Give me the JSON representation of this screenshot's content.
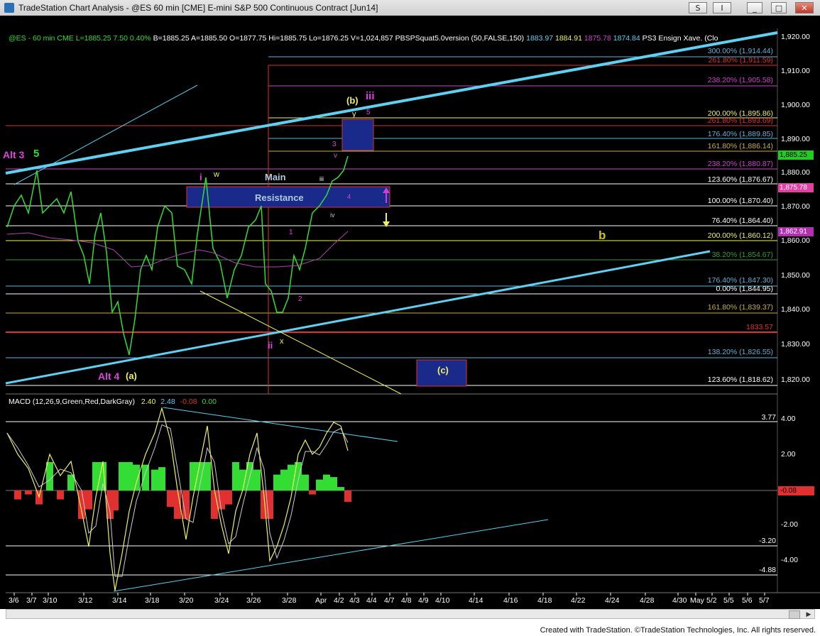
{
  "window": {
    "title": "TradeStation Chart Analysis - @ES 60 min [CME] E-mini S&P 500 Continuous Contract [Jun14]",
    "buttons": [
      "S",
      "I",
      "_",
      "□",
      "✕"
    ]
  },
  "info_bar": {
    "symbol": "@ES - 60 min  CME",
    "last": "L=1885.25 7.50 0.40%",
    "bid": "B=1885.25",
    "ask": "A=1885.50",
    "open": "O=1877.75",
    "high": "Hi=1885.75",
    "low": "Lo=1876.25",
    "volume": "V=1,024,857",
    "indicator": "PBSPSquat5.0version (50,FALSE,150)",
    "ind_values": [
      "1883.97",
      "1884.91",
      "1875.78",
      "1874.84"
    ],
    "ind2": "PS3 Ensign Xave. (Clo"
  },
  "price_axis": [
    "1,920.00",
    "1,910.00",
    "1,900.00",
    "1,890.00",
    "1,880.00",
    "1,870.00",
    "1,860.00",
    "1,850.00",
    "1,840.00",
    "1,830.00",
    "1,820.00"
  ],
  "price_badges": {
    "last": "1,885.25",
    "pink": "1,875.78",
    "magenta": "1,862.91"
  },
  "fib_labels": [
    {
      "text": "300.00% (1,914.44)",
      "color": "#5fb2d8"
    },
    {
      "text": "261.80% (1,911.59)",
      "color": "#e03030"
    },
    {
      "text": "238.20% (1,905.58)",
      "color": "#d040d0"
    },
    {
      "text": "200.00% (1,895.86)",
      "color": "#f0f060"
    },
    {
      "text": "261.80% (1,893.69)",
      "color": "#e03030"
    },
    {
      "text": "176.40% (1,889.85)",
      "color": "#5fb2d8"
    },
    {
      "text": "161.80% (1,886.14)",
      "color": "#c8b040"
    },
    {
      "text": "238.20% (1,880.87)",
      "color": "#d040d0"
    },
    {
      "text": "123.60% (1,876.67)",
      "color": "#ffffff"
    },
    {
      "text": "100.00% (1,870.40)",
      "color": "#ffffff"
    },
    {
      "text": "76.40% (1,864.40)",
      "color": "#ffffff"
    },
    {
      "text": "200.00% (1,860.12)",
      "color": "#f0f060"
    },
    {
      "text": "38.20% (1,854.67)",
      "color": "#3a9a3a"
    },
    {
      "text": "176.40% (1,847.30)",
      "color": "#5fb2d8"
    },
    {
      "text": "0.00% (1,844.95)",
      "color": "#ffffff"
    },
    {
      "text": "161.80% (1,839.37)",
      "color": "#c8b040"
    },
    {
      "text": "1833.57",
      "color": "#e03030"
    },
    {
      "text": "138.20% (1,826.55)",
      "color": "#5fb2d8"
    },
    {
      "text": "123.60% (1,818.62)",
      "color": "#ffffff"
    }
  ],
  "wave_labels": {
    "alt3": "Alt 3",
    "five": "5",
    "i": "i",
    "w": "w",
    "main": "Main",
    "resistance": "Resistance",
    "b_paren": "(b)",
    "iii": "iii",
    "y": "y",
    "five_small": "5",
    "three": "3",
    "v": "v",
    "iii_small": "iii",
    "four": "4",
    "iv": "iv",
    "one": "1",
    "two": "2",
    "ii": "ii",
    "x": "x",
    "alt4": "Alt 4",
    "a_paren": "(a)",
    "c_paren": "(c)",
    "b": "b"
  },
  "macd": {
    "label": "MACD (12,26,9,Green,Red,DarkGray)",
    "values": [
      "2.40",
      "2.48",
      "-0.08",
      "0.00"
    ],
    "axis": [
      "4.00",
      "2.00",
      "-2.00",
      "-4.00"
    ],
    "levels": [
      "3.77",
      "-0.08",
      "-3.20",
      "-4.88"
    ]
  },
  "date_axis": [
    "3/6",
    "3/7",
    "3/10",
    "3/12",
    "3/14",
    "3/18",
    "3/20",
    "3/24",
    "3/26",
    "3/28",
    "Apr",
    "4/2",
    "4/3",
    "4/4",
    "4/7",
    "4/8",
    "4/9",
    "4/10",
    "4/14",
    "4/16",
    "4/18",
    "4/22",
    "4/24",
    "4/28",
    "4/30",
    "May",
    "5/2",
    "5/5",
    "5/6",
    "5/7"
  ],
  "footer": "Created with TradeStation. ©TradeStation Technologies, Inc. All rights reserved."
}
